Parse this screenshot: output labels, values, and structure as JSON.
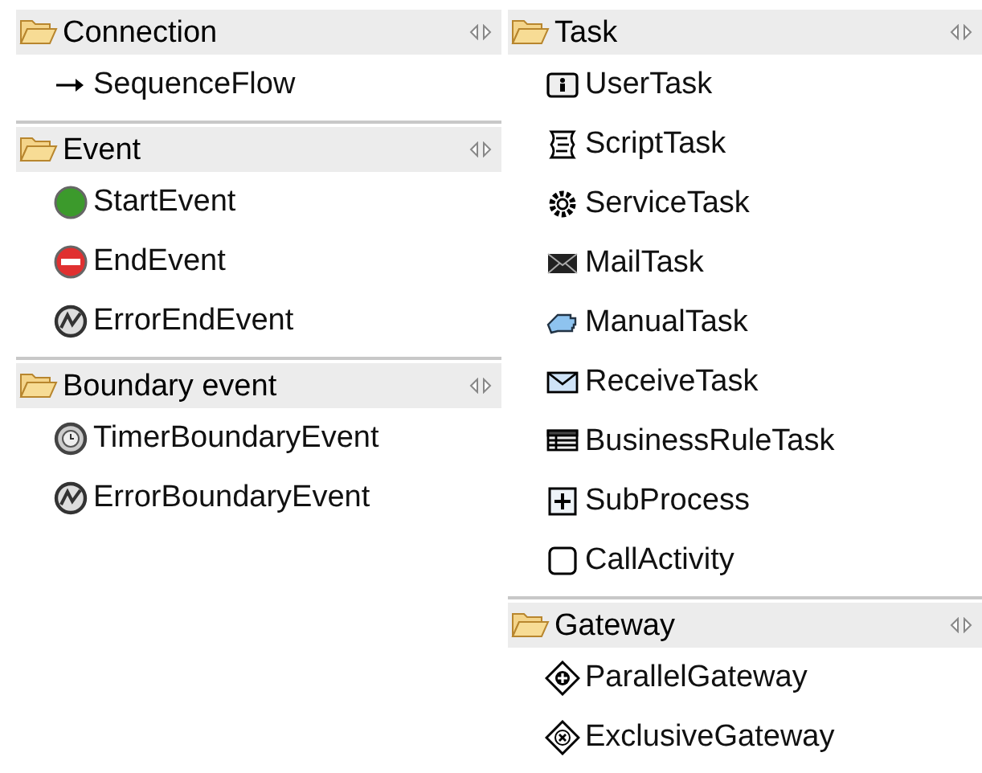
{
  "columns": [
    {
      "groups": [
        {
          "title": "Connection",
          "expanded": true,
          "items": [
            {
              "label": "SequenceFlow",
              "kind": "flow"
            }
          ]
        },
        {
          "title": "Event",
          "expanded": true,
          "items": [
            {
              "label": "StartEvent",
              "kind": "start"
            },
            {
              "label": "EndEvent",
              "kind": "end"
            },
            {
              "label": "ErrorEndEvent",
              "kind": "error"
            }
          ]
        },
        {
          "title": "Boundary event",
          "expanded": true,
          "items": [
            {
              "label": "TimerBoundaryEvent",
              "kind": "timer"
            },
            {
              "label": "ErrorBoundaryEvent",
              "kind": "error"
            }
          ]
        }
      ]
    },
    {
      "groups": [
        {
          "title": "Task",
          "expanded": true,
          "items": [
            {
              "label": "UserTask",
              "kind": "user"
            },
            {
              "label": "ScriptTask",
              "kind": "script"
            },
            {
              "label": "ServiceTask",
              "kind": "service"
            },
            {
              "label": "MailTask",
              "kind": "mail"
            },
            {
              "label": "ManualTask",
              "kind": "manual"
            },
            {
              "label": "ReceiveTask",
              "kind": "receive"
            },
            {
              "label": "BusinessRuleTask",
              "kind": "rule"
            },
            {
              "label": "SubProcess",
              "kind": "subprocess"
            },
            {
              "label": "CallActivity",
              "kind": "call"
            }
          ]
        },
        {
          "title": "Gateway",
          "expanded": true,
          "items": [
            {
              "label": "ParallelGateway",
              "kind": "parallel"
            },
            {
              "label": "ExclusiveGateway",
              "kind": "exclusive"
            }
          ]
        }
      ]
    }
  ]
}
